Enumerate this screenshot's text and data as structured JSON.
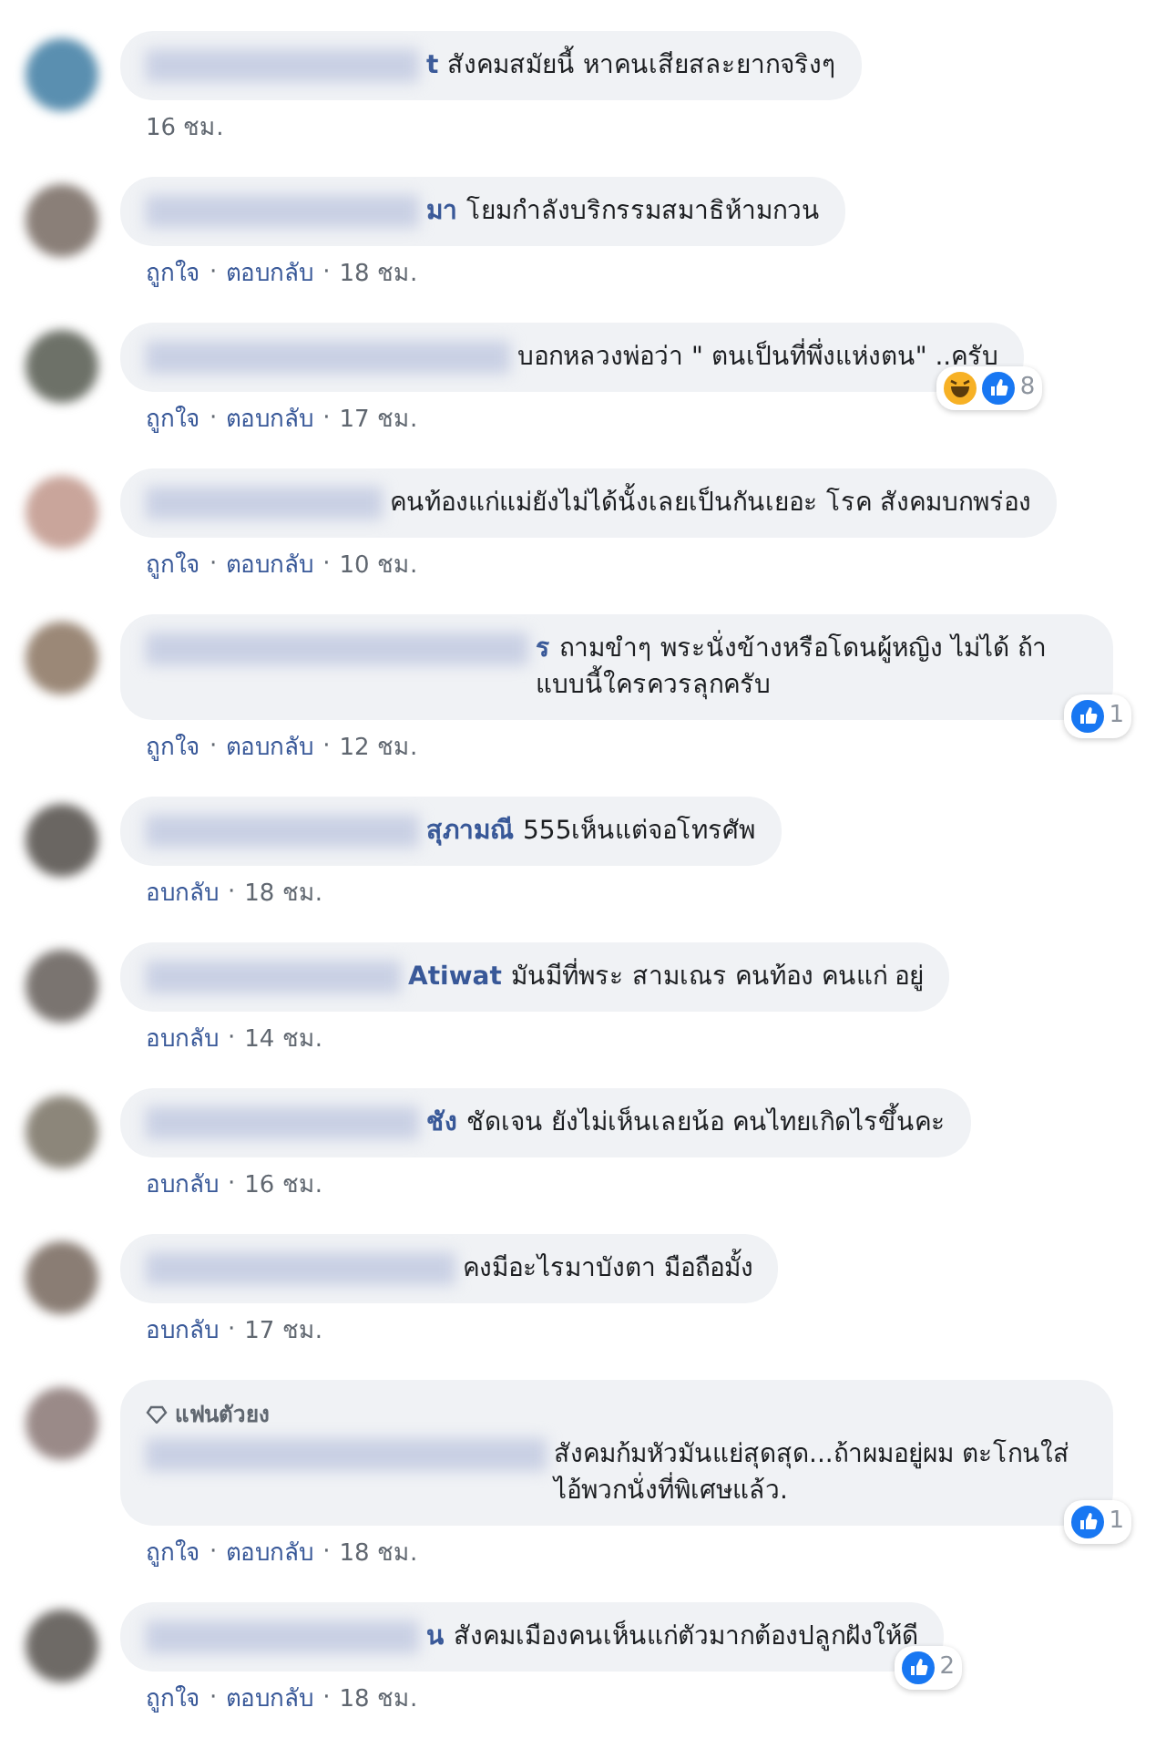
{
  "comments": [
    {
      "name": "t",
      "text": "สังคมสมัยนี้ หาคนเสียสละยากจริงๆ",
      "meta": [
        "16 ชม."
      ]
    },
    {
      "name": "มา",
      "text": "โยมกำลังบริกรรมสมาธิห้ามกวน",
      "meta": [
        "ถูกใจ",
        "·",
        "ตอบกลับ",
        "·",
        "18 ชม."
      ]
    },
    {
      "text": "บอกหลวงพ่อว่า \" ตนเป็นที่พึ่งแห่งตน\" ..ครับ",
      "meta": [
        "ถูกใจ",
        "·",
        "ตอบกลับ",
        "·",
        "17 ชม."
      ],
      "reactions": {
        "haha": true,
        "count": "8"
      }
    },
    {
      "text": "คนท้องแก่แม่ยังไม่ได้นั้งเลยเป็นกันเยอะ โรค สังคมบกพร่อง",
      "meta": [
        "ถูกใจ",
        "·",
        "ตอบกลับ",
        "·",
        "10 ชม."
      ]
    },
    {
      "name": "ร",
      "text": "ถามขำๆ พระนั่งข้างหรือโดนผู้หญิง ไม่ได้ ถ้าแบบนี้ใครควรลุกครับ",
      "meta": [
        "ถูกใจ",
        "·",
        "ตอบกลับ",
        "·",
        "12 ชม."
      ],
      "reactions": {
        "count": "1"
      }
    },
    {
      "name": "สุภามณี",
      "text": "555เห็นแต่จอโทรศัพ",
      "meta": [
        "อบกลับ",
        "·",
        "18 ชม."
      ]
    },
    {
      "name": "Atiwat",
      "text": "มันมีที่พระ สามเณร คนท้อง คนแก่ อยู่",
      "meta": [
        "อบกลับ",
        "·",
        "14 ชม."
      ]
    },
    {
      "name": "ชัง",
      "text": "ชัดเจน ยังไม่เห็นเลยน้อ คนไทยเกิดไรขึ้นคะ",
      "meta": [
        "อบกลับ",
        "·",
        "16 ชม."
      ]
    },
    {
      "text": "คงมีอะไรมาบังตา มือถือมั้ง",
      "meta": [
        "อบกลับ",
        "·",
        "17 ชม."
      ]
    },
    {
      "badge": "แฟนตัวยง",
      "text": "สังคมก้มหัวมันแย่สุดสุด...ถ้าผมอยู่ผม ตะโกนใส่ไอ้พวกนั่งที่พิเศษแล้ว.",
      "meta": [
        "ถูกใจ",
        "·",
        "ตอบกลับ",
        "·",
        "18 ชม."
      ],
      "reactions": {
        "count": "1"
      }
    },
    {
      "name": "น",
      "text": "สังคมเมืองคนเห็นแก่ตัวมากต้องปลูกฝังให้ดี",
      "meta": [
        "ถูกใจ",
        "·",
        "ตอบกลับ",
        "·",
        "18 ชม."
      ],
      "reactions": {
        "count": "2"
      }
    }
  ]
}
